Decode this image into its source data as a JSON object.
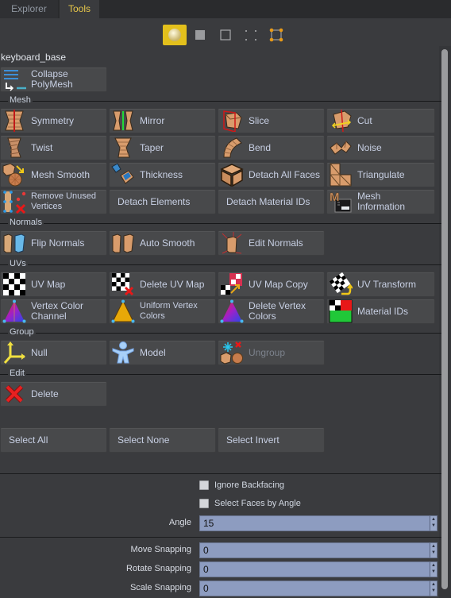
{
  "tabs": [
    {
      "label": "Explorer",
      "active": false
    },
    {
      "label": "Tools",
      "active": true
    }
  ],
  "mode_bar": [
    {
      "name": "object-mode",
      "icon": "sphere-icon",
      "active": true
    },
    {
      "name": "face-mode",
      "icon": "filled-square-icon",
      "active": false
    },
    {
      "name": "edge-mode",
      "icon": "outline-square-icon",
      "active": false
    },
    {
      "name": "vertex-mode",
      "icon": "dots-icon",
      "active": false
    },
    {
      "name": "transform-mode",
      "icon": "bounding-box-icon",
      "active": false
    }
  ],
  "object_name": "keyboard_base",
  "collapse_button": {
    "label_line1": "Collapse",
    "label_line2": "PolyMesh",
    "icon": "collapse-icon"
  },
  "sections": {
    "mesh": {
      "title": "Mesh",
      "buttons": [
        {
          "label": "Symmetry",
          "icon": "symmetry-icon"
        },
        {
          "label": "Mirror",
          "icon": "mirror-icon"
        },
        {
          "label": "Slice",
          "icon": "slice-icon"
        },
        {
          "label": "Cut",
          "icon": "cut-icon"
        },
        {
          "label": "Twist",
          "icon": "twist-icon"
        },
        {
          "label": "Taper",
          "icon": "taper-icon"
        },
        {
          "label": "Bend",
          "icon": "bend-icon"
        },
        {
          "label": "Noise",
          "icon": "noise-icon"
        },
        {
          "label": "Mesh Smooth",
          "icon": "mesh-smooth-icon"
        },
        {
          "label": "Thickness",
          "icon": "thickness-icon"
        },
        {
          "label": "Detach All Faces",
          "icon": "detach-faces-icon"
        },
        {
          "label": "Triangulate",
          "icon": "triangulate-icon"
        },
        {
          "label_line1": "Remove Unused",
          "label_line2": "Vertices",
          "icon": "remove-vertices-icon"
        },
        {
          "label": "Detach Elements"
        },
        {
          "label": "Detach Material IDs"
        },
        {
          "label_line1": "Mesh",
          "label_line2": "Information",
          "icon": "mesh-info-icon"
        }
      ]
    },
    "normals": {
      "title": "Normals",
      "buttons": [
        {
          "label": "Flip Normals",
          "icon": "flip-normals-icon"
        },
        {
          "label": "Auto Smooth",
          "icon": "auto-smooth-icon"
        },
        {
          "label": "Edit Normals",
          "icon": "edit-normals-icon"
        }
      ]
    },
    "uvs": {
      "title": "UVs",
      "buttons": [
        {
          "label": "UV Map",
          "icon": "checker-icon"
        },
        {
          "label": "Delete UV Map",
          "icon": "delete-uv-icon"
        },
        {
          "label": "UV Map Copy",
          "icon": "uv-copy-icon"
        },
        {
          "label": "UV Transform",
          "icon": "uv-transform-icon"
        },
        {
          "label_line1": "Vertex Color",
          "label_line2": "Channel",
          "icon": "vertex-color-icon"
        },
        {
          "label_line1": "Uniform Vertex",
          "label_line2": "Colors",
          "icon": "uniform-color-icon"
        },
        {
          "label_line1": "Delete Vertex",
          "label_line2": "Colors",
          "icon": "delete-vertex-color-icon"
        },
        {
          "label": "Material IDs",
          "icon": "material-ids-icon"
        }
      ]
    },
    "group": {
      "title": "Group",
      "buttons": [
        {
          "label": "Null",
          "icon": "null-axes-icon"
        },
        {
          "label": "Model",
          "icon": "model-figure-icon"
        },
        {
          "label": "Ungroup",
          "icon": "ungroup-icon",
          "disabled": true
        }
      ]
    },
    "edit": {
      "title": "Edit",
      "buttons": [
        {
          "label": "Delete",
          "icon": "delete-x-icon"
        }
      ]
    }
  },
  "selection": {
    "select_all": "Select All",
    "select_none": "Select None",
    "select_invert": "Select Invert"
  },
  "options": {
    "ignore_backfacing": {
      "label": "Ignore Backfacing",
      "checked": false
    },
    "select_faces_by_angle": {
      "label": "Select Faces by Angle",
      "checked": false
    },
    "angle": {
      "label": "Angle",
      "value": "15"
    }
  },
  "snapping": {
    "move": {
      "label": "Move Snapping",
      "value": "0"
    },
    "rotate": {
      "label": "Rotate Snapping",
      "value": "0"
    },
    "scale": {
      "label": "Scale Snapping",
      "value": "0"
    }
  },
  "colors": {
    "accent": "#e3c01c",
    "active_tab_text": "#e8c84a",
    "background": "#3a3b3e",
    "button": "#48494b",
    "spinbox": "#8d9cc0"
  }
}
